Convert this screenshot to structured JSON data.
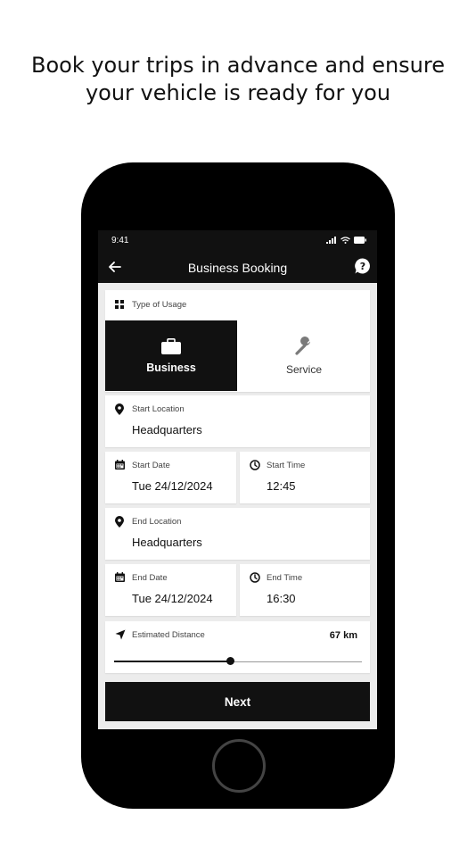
{
  "headline": {
    "line1": "Book your trips in advance and ensure",
    "line2": "your vehicle is ready for you"
  },
  "status_bar": {
    "time": "9:41"
  },
  "app_bar": {
    "title": "Business Booking",
    "back_icon": "arrow-left-icon",
    "help_icon": "help-bubble-icon"
  },
  "usage": {
    "label": "Type of Usage",
    "icon": "grid-icon",
    "options": [
      {
        "label": "Business",
        "icon": "briefcase-icon",
        "selected": true
      },
      {
        "label": "Service",
        "icon": "wrench-icon",
        "selected": false
      }
    ]
  },
  "start_location": {
    "label": "Start Location",
    "value": "Headquarters",
    "icon": "map-pin-icon"
  },
  "start_date": {
    "label": "Start Date",
    "value": "Tue 24/12/2024",
    "icon": "calendar-icon"
  },
  "start_time": {
    "label": "Start Time",
    "value": "12:45",
    "icon": "clock-icon"
  },
  "end_location": {
    "label": "End Location",
    "value": "Headquarters",
    "icon": "map-pin-icon"
  },
  "end_date": {
    "label": "End Date",
    "value": "Tue 24/12/2024",
    "icon": "calendar-icon"
  },
  "end_time": {
    "label": "End Time",
    "value": "16:30",
    "icon": "clock-icon"
  },
  "distance": {
    "label": "Estimated Distance",
    "value": "67 km",
    "icon": "navigation-arrow-icon",
    "slider_fraction": 0.47
  },
  "next_button": {
    "label": "Next"
  },
  "colors": {
    "primary": "#111111",
    "surface": "#ffffff",
    "background": "#ececec"
  }
}
